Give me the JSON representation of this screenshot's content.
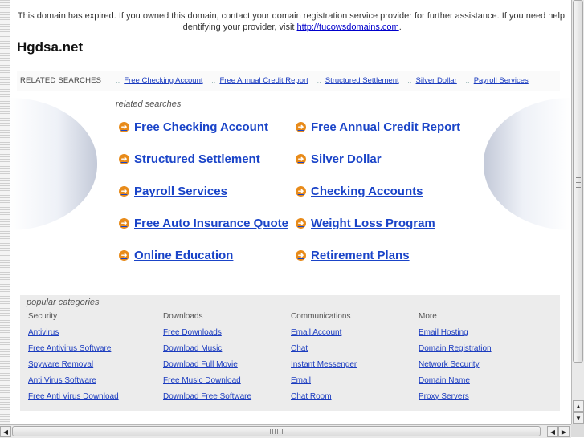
{
  "notice": {
    "text": "This domain has expired. If you owned this domain, contact your domain registration service provider for further assistance. If you need help identifying your provider, visit ",
    "link": "http://tucowsdomains.com",
    "after": "."
  },
  "site": {
    "title": "Hgdsa.net"
  },
  "related_bar": {
    "title": "RELATED SEARCHES",
    "separator": "::",
    "links": [
      "Free Checking Account",
      "Free Annual Credit Report",
      "Structured Settlement",
      "Silver Dollar",
      "Payroll Services"
    ]
  },
  "related_searches": {
    "label": "related searches",
    "arrow_icon": "arrow-right-icon",
    "items": [
      "Free Checking Account",
      "Free Annual Credit Report",
      "Structured Settlement",
      "Silver Dollar",
      "Payroll Services",
      "Checking Accounts",
      "Free Auto Insurance Quote",
      "Weight Loss Program",
      "Online Education",
      "Retirement Plans"
    ]
  },
  "popular": {
    "title": "popular categories",
    "columns": [
      {
        "heading": "Security",
        "items": [
          "Antivirus",
          "Free Antivirus Software",
          "Spyware Removal",
          "Anti Virus Software",
          "Free Anti Virus Download"
        ]
      },
      {
        "heading": "Downloads",
        "items": [
          "Free Downloads",
          "Download Music",
          "Download Full Movie",
          "Free Music Download",
          "Download Free Software"
        ]
      },
      {
        "heading": "Communications",
        "items": [
          "Email Account",
          "Chat",
          "Instant Messenger",
          "Email",
          "Chat Room"
        ]
      },
      {
        "heading": "More",
        "items": [
          "Email Hosting",
          "Domain Registration",
          "Network Security",
          "Domain Name",
          "Proxy Servers"
        ]
      }
    ]
  },
  "scrollbars": {
    "up": "▲",
    "down": "▼",
    "left": "◀",
    "right": "▶"
  },
  "colors": {
    "link": "#1a44c8",
    "arrow": "#e88b1a",
    "panel": "#ececec"
  }
}
